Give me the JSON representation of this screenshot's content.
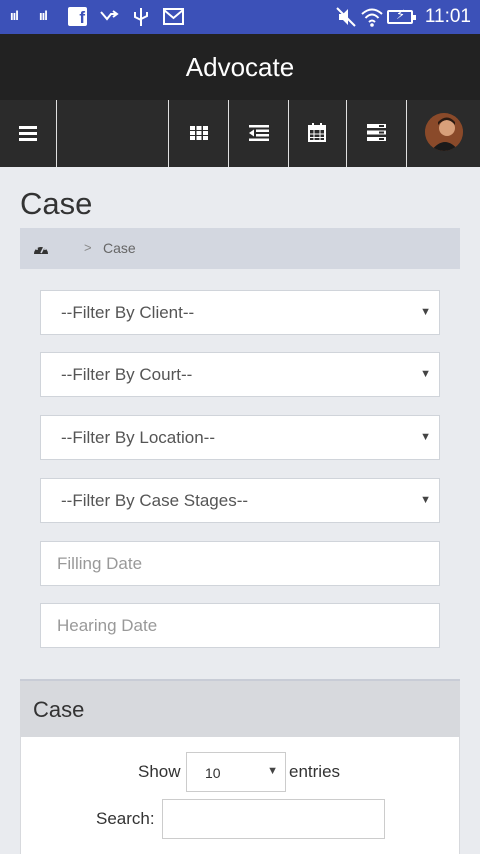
{
  "status_bar": {
    "signal_1": "ııl",
    "signal_2": "ııl",
    "time": "11:01",
    "icons": [
      "signal-icon",
      "signal-icon",
      "facebook-icon",
      "missed-call-icon",
      "usb-icon",
      "gmail-icon",
      "mute-icon",
      "wifi-icon",
      "battery-charging-icon"
    ]
  },
  "app": {
    "title": "Advocate"
  },
  "toolbar": {
    "icons": [
      "menu-icon",
      "grid-icon",
      "indent-icon",
      "calendar-icon",
      "list-icon",
      "user-avatar"
    ]
  },
  "page": {
    "title": "Case",
    "breadcrumb": {
      "separator": ">",
      "current": "Case"
    }
  },
  "filters": {
    "client": "--Filter By Client--",
    "court": "--Filter By Court--",
    "location": "--Filter By Location--",
    "case_stages": "--Filter By Case Stages--",
    "filling_date_placeholder": "Filling Date",
    "hearing_date_placeholder": "Hearing Date"
  },
  "panel": {
    "title": "Case",
    "show_label": "Show",
    "entries_value": "10",
    "entries_label": "entries",
    "search_label": "Search:"
  }
}
